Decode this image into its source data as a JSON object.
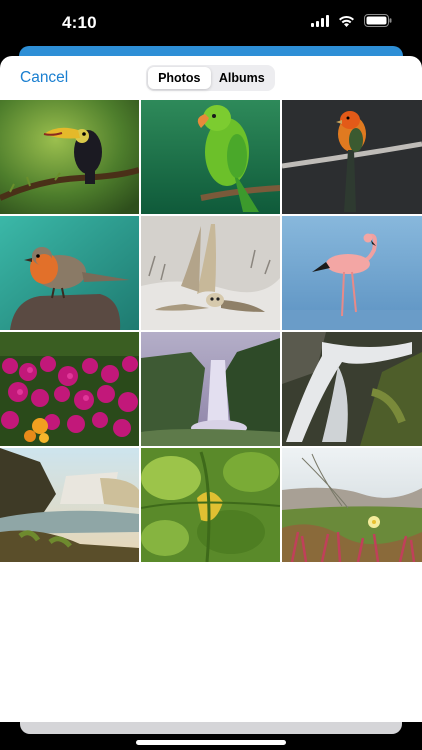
{
  "status_bar": {
    "time": "4:10"
  },
  "picker": {
    "cancel_label": "Cancel",
    "tabs": [
      {
        "label": "Photos",
        "selected": true
      },
      {
        "label": "Albums",
        "selected": false
      }
    ]
  },
  "photos": [
    {
      "subject": "toucan"
    },
    {
      "subject": "green-parrot"
    },
    {
      "subject": "orange-bird-on-branch"
    },
    {
      "subject": "robin"
    },
    {
      "subject": "owl-in-flight"
    },
    {
      "subject": "flamingo"
    },
    {
      "subject": "pink-flowers"
    },
    {
      "subject": "waterfall-valley"
    },
    {
      "subject": "waterfall-rocks"
    },
    {
      "subject": "waterfall-cliff"
    },
    {
      "subject": "green-leaves"
    },
    {
      "subject": "coastal-plants"
    }
  ],
  "colors": {
    "accent": "#1a7fd0",
    "behind_sheet": "#2e8fd6"
  }
}
